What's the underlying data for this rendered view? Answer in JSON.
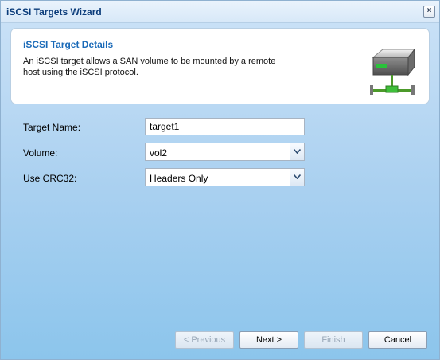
{
  "window": {
    "title": "iSCSI Targets Wizard",
    "close_glyph": "×"
  },
  "header": {
    "title": "iSCSI Target Details",
    "description": "An iSCSI target allows a SAN volume to be mounted by a remote host using the iSCSI protocol.",
    "icon": "network-storage-icon"
  },
  "form": {
    "target_name": {
      "label": "Target Name:",
      "value": "target1"
    },
    "volume": {
      "label": "Volume:",
      "value": "vol2"
    },
    "crc32": {
      "label": "Use CRC32:",
      "value": "Headers Only"
    }
  },
  "buttons": {
    "previous": {
      "label": "< Previous",
      "enabled": false
    },
    "next": {
      "label": "Next >",
      "enabled": true
    },
    "finish": {
      "label": "Finish",
      "enabled": false
    },
    "cancel": {
      "label": "Cancel",
      "enabled": true
    }
  },
  "colors": {
    "title_text": "#0b3c7a",
    "header_title": "#1a6ab8",
    "background_top": "#d3e6f8",
    "background_bottom": "#8cc5ec"
  }
}
